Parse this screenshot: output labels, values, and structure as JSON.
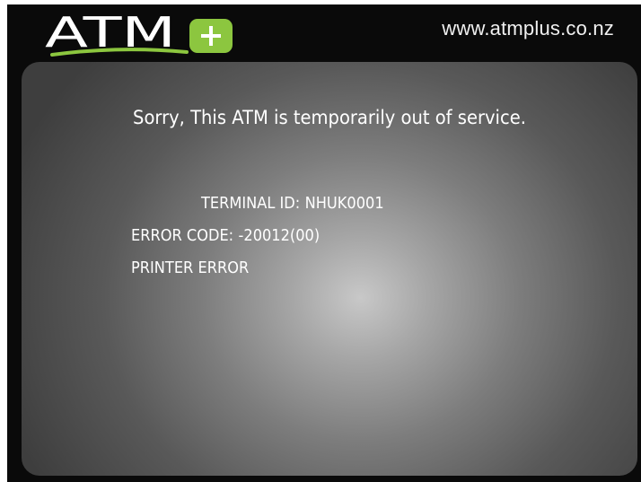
{
  "header": {
    "logo_text": "ATM",
    "logo_plus": "+",
    "website": "www.atmplus.co.nz"
  },
  "message": {
    "headline": "Sorry, This ATM is temporarily out of service.",
    "terminal_label": "TERMINAL ID:",
    "terminal_id": "NHUK0001",
    "error_code_label": "ERROR CODE:",
    "error_code": "-20012(00)",
    "error_description": "PRINTER ERROR"
  },
  "colors": {
    "background": "#0a0a0a",
    "logo_green": "#8cc63f",
    "text": "#ffffff"
  },
  "icons": {
    "logo": "atm-plus-logo"
  }
}
